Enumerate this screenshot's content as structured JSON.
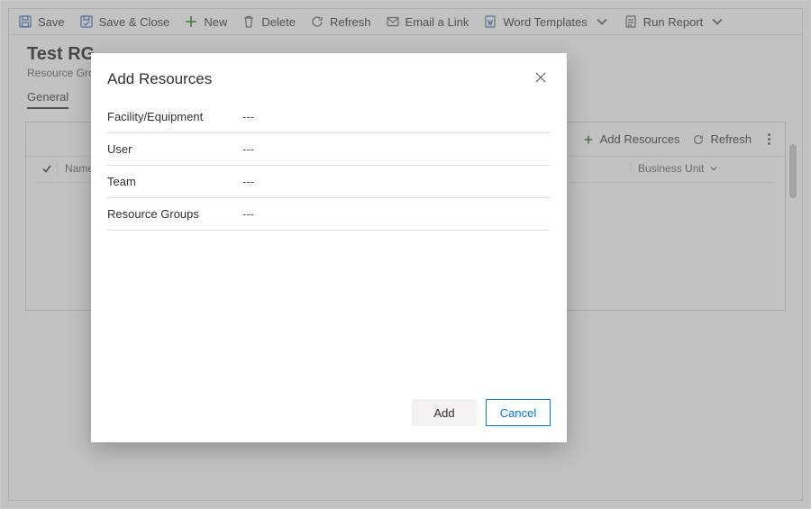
{
  "toolbar": {
    "save": "Save",
    "save_close": "Save & Close",
    "new": "New",
    "delete": "Delete",
    "refresh": "Refresh",
    "email_link": "Email a Link",
    "word_templates": "Word Templates",
    "run_report": "Run Report"
  },
  "header": {
    "title": "Test RG",
    "subtitle": "Resource Group"
  },
  "tabs": {
    "general": "General"
  },
  "grid": {
    "toolbar": {
      "add_resources": "Add Resources",
      "refresh": "Refresh"
    },
    "columns": {
      "name": "Name",
      "unit": "Business Unit"
    }
  },
  "dialog": {
    "title": "Add Resources",
    "fields": [
      {
        "label": "Facility/Equipment",
        "value": "---"
      },
      {
        "label": "User",
        "value": "---"
      },
      {
        "label": "Team",
        "value": "---"
      },
      {
        "label": "Resource Groups",
        "value": "---"
      }
    ],
    "buttons": {
      "add": "Add",
      "cancel": "Cancel"
    }
  }
}
